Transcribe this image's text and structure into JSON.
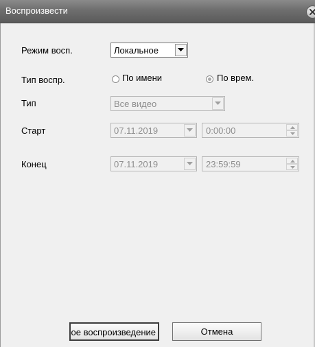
{
  "window": {
    "title": "Воспроизвести"
  },
  "fields": {
    "mode_label": "Режим восп.",
    "mode_value": "Локальное",
    "playtype_label": "Тип воспр.",
    "by_name_label": "По имени",
    "by_time_label": "По врем.",
    "type_label": "Тип",
    "type_value": "Все видео",
    "start_label": "Старт",
    "start_date": "07.11.2019",
    "start_time": "0:00:00",
    "end_label": "Конец",
    "end_date": "07.11.2019",
    "end_time": "23:59:59"
  },
  "buttons": {
    "play_label": "Локальное воспроизведение",
    "cancel_label": "Отмена"
  },
  "state": {
    "selected_play_type": "by_time"
  }
}
